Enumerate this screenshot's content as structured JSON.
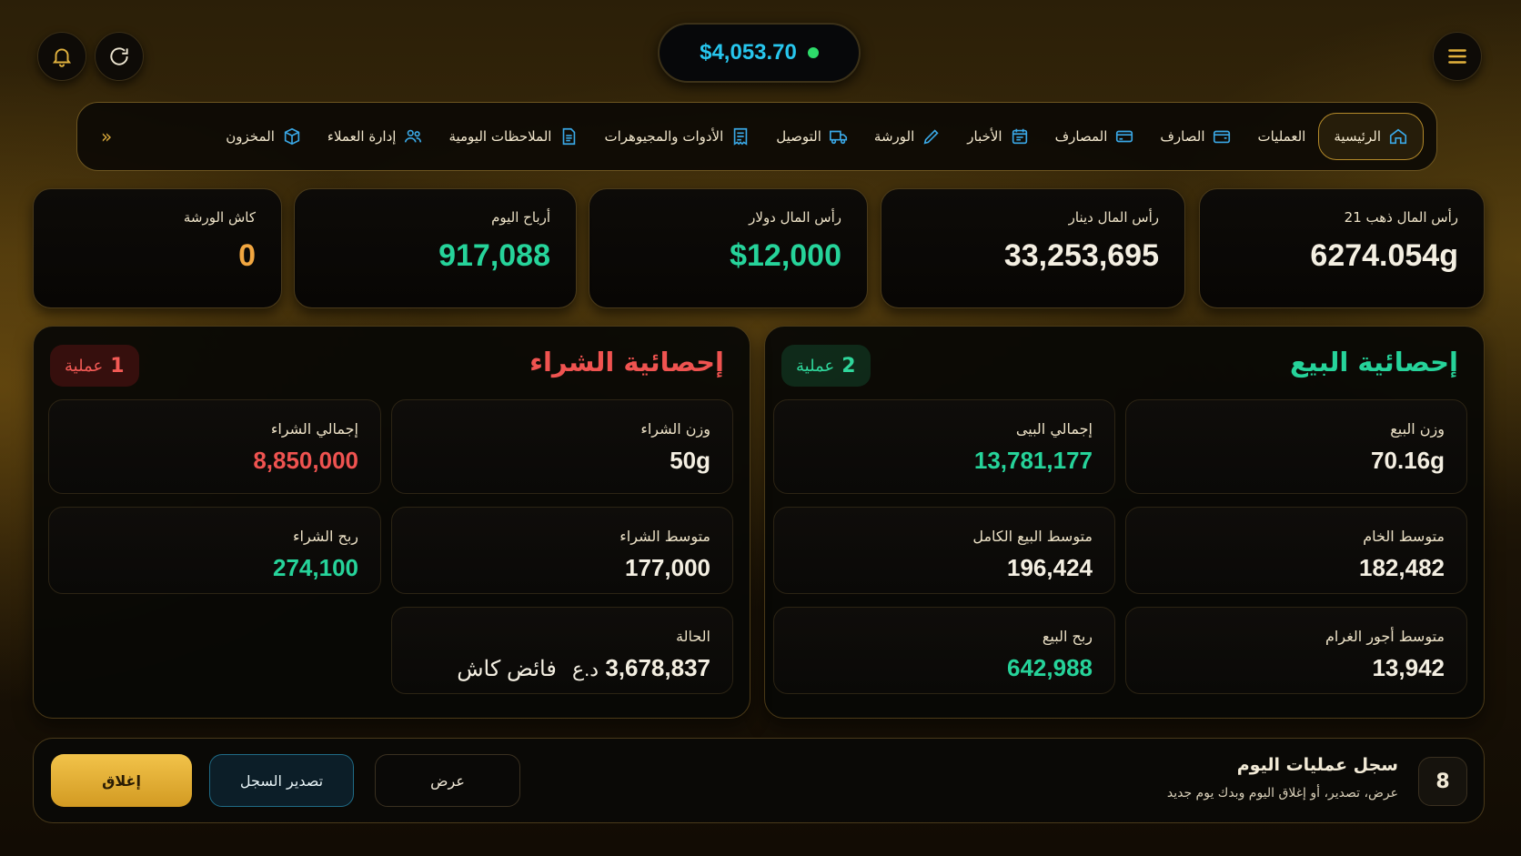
{
  "header": {
    "balance": "$4,053.70",
    "bell_icon": "bell-icon",
    "refresh_icon": "refresh-icon",
    "menu_icon": "hamburger-menu-icon"
  },
  "nav": {
    "items": [
      {
        "label": "الرئيسية",
        "icon": "home-icon",
        "active": true
      },
      {
        "label": "العمليات",
        "icon": "",
        "active": false
      },
      {
        "label": "الصارف",
        "icon": "wallet-icon",
        "active": false
      },
      {
        "label": "المصارف",
        "icon": "card-icon",
        "active": false
      },
      {
        "label": "الأخبار",
        "icon": "calendar-icon",
        "active": false
      },
      {
        "label": "الورشة",
        "icon": "pencil-icon",
        "active": false
      },
      {
        "label": "التوصيل",
        "icon": "truck-icon",
        "active": false
      },
      {
        "label": "الأدوات والمجيوهرات",
        "icon": "receipt-icon",
        "active": false
      },
      {
        "label": "الملاحظات اليومية",
        "icon": "document-icon",
        "active": false
      },
      {
        "label": "إدارة العملاء",
        "icon": "users-icon",
        "active": false
      },
      {
        "label": "المخزون",
        "icon": "box-icon",
        "active": false
      }
    ],
    "more": "»"
  },
  "stats": [
    {
      "label": "رأس المال ذهب 21",
      "value": "6274.054g",
      "color": "#f4efe2"
    },
    {
      "label": "رأس المال دينار",
      "value": "33,253,695",
      "color": "#f4efe2"
    },
    {
      "label": "رأس المال دولار",
      "value": "$12,000",
      "color": "#26d39a"
    },
    {
      "label": "أرباح اليوم",
      "value": "917,088",
      "color": "#26d39a"
    },
    {
      "label": "كاش الورشة",
      "value": "0",
      "color": "#f1a640"
    }
  ],
  "sales": {
    "title": "إحصائية البيع",
    "badge_count": "2",
    "badge_label": "عملية",
    "cards": [
      {
        "label": "وزن البيع",
        "value": "70.16g"
      },
      {
        "label": "إجمالي البيى",
        "value": "13,781,177"
      },
      {
        "label": "متوسط الخام",
        "value": "182,482"
      },
      {
        "label": "متوسط البيع الكامل",
        "value": "196,424"
      },
      {
        "label": "متوسط أجور الغرام",
        "value": "13,942"
      },
      {
        "label": "ربح البيع",
        "value": "642,988"
      }
    ]
  },
  "purchase": {
    "title": "إحصائية الشراء",
    "badge_count": "1",
    "badge_label": "عملية",
    "cards": [
      {
        "label": "وزن الشراء",
        "value": "50g"
      },
      {
        "label": "إجمالي الشراء",
        "value": "8,850,000"
      },
      {
        "label": "متوسط الشراء",
        "value": "177,000"
      },
      {
        "label": "ربح الشراء",
        "value": "274,100"
      }
    ],
    "status": {
      "label": "الحالة",
      "amount": "3,678,837",
      "currency": "د.ع",
      "note": "فائض كاش"
    }
  },
  "log": {
    "count": "8",
    "title": "سجل عمليات اليوم",
    "subtitle": "عرض، تصدير، أو إغلاق اليوم وبدك يوم جديد",
    "view_label": "عرض",
    "export_label": "تصدير السجل",
    "close_label": "إغلاق"
  }
}
